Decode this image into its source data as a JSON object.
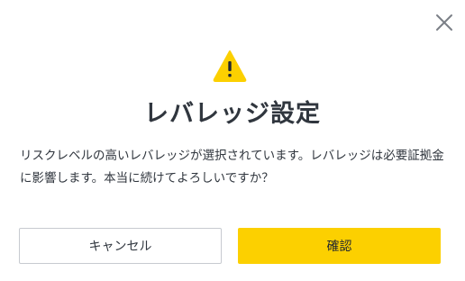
{
  "dialog": {
    "title": "レバレッジ設定",
    "message": "リスクレベルの高いレバレッジが選択されています。レバレッジは必要証拠金に影響します。本当に続けてよろしいですか？",
    "warning_icon": "warning-triangle-icon",
    "close_icon": "close-icon",
    "cancel_label": "キャンセル",
    "confirm_label": "確認"
  },
  "colors": {
    "accent": "#fcd000",
    "text": "#30363e",
    "border": "#c7cad0",
    "close_icon": "#7b7f87"
  }
}
